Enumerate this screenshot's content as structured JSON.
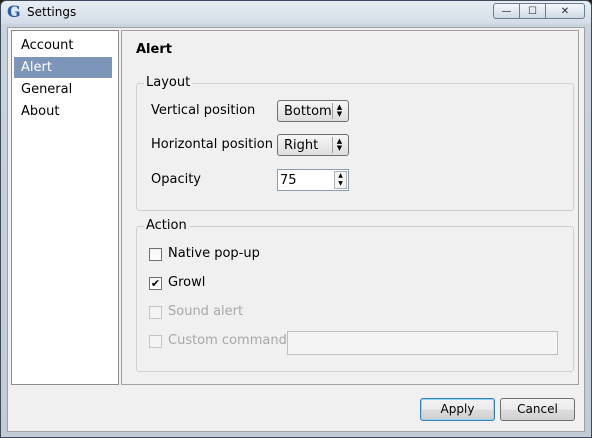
{
  "window": {
    "title": "Settings",
    "app_icon": "G"
  },
  "sidebar": {
    "items": [
      {
        "label": "Account",
        "selected": false
      },
      {
        "label": "Alert",
        "selected": true
      },
      {
        "label": "General",
        "selected": false
      },
      {
        "label": "About",
        "selected": false
      }
    ]
  },
  "page": {
    "title": "Alert",
    "layout": {
      "label": "Layout",
      "vertical_label": "Vertical position",
      "vertical_value": "Bottom",
      "horizontal_label": "Horizontal position",
      "horizontal_value": "Right",
      "opacity_label": "Opacity",
      "opacity_value": "75"
    },
    "action": {
      "label": "Action",
      "native_popup_label": "Native pop-up",
      "native_popup_checked": false,
      "growl_label": "Growl",
      "growl_checked": true,
      "sound_alert_label": "Sound alert",
      "sound_alert_checked": false,
      "custom_command_label": "Custom command",
      "custom_command_checked": false,
      "custom_command_value": ""
    }
  },
  "buttons": {
    "apply": "Apply",
    "cancel": "Cancel"
  },
  "icons": {
    "check": "✔",
    "min": "—",
    "max": "☐",
    "close": "✕",
    "up": "▲",
    "down": "▼"
  }
}
